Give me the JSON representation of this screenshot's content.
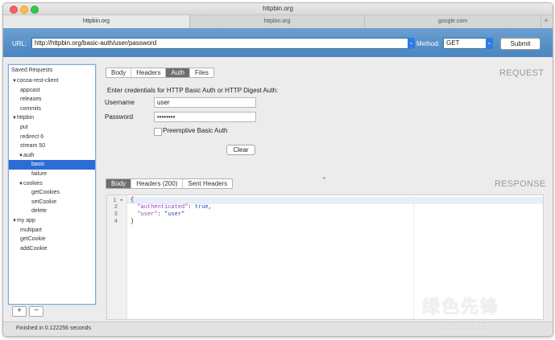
{
  "window": {
    "title": "httpbin.org"
  },
  "tabs": [
    {
      "label": "httpbin.org",
      "active": true
    },
    {
      "label": "httpbin.org",
      "active": false
    },
    {
      "label": "google.com",
      "active": false
    }
  ],
  "tab_add_label": "+",
  "urlbar": {
    "url_label": "URL:",
    "url_value": "http://httpbin.org/basic-auth/user/password",
    "method_label": "Method:",
    "method_value": "GET",
    "submit_label": "Submit"
  },
  "sidebar": {
    "title": "Saved Requests",
    "items": [
      {
        "label": "cocoa-rest-client",
        "level": 0,
        "folder": true
      },
      {
        "label": "appcast",
        "level": 2
      },
      {
        "label": "releases",
        "level": 2
      },
      {
        "label": "commits",
        "level": 2
      },
      {
        "label": "httpbin",
        "level": 0,
        "folder": true
      },
      {
        "label": "put",
        "level": 2
      },
      {
        "label": "redirect 6",
        "level": 2
      },
      {
        "label": "stream 50",
        "level": 2
      },
      {
        "label": "auth",
        "level": 1,
        "folder": true
      },
      {
        "label": "basic",
        "level": 3,
        "selected": true
      },
      {
        "label": "failure",
        "level": 3
      },
      {
        "label": "cookies",
        "level": 1,
        "folder": true
      },
      {
        "label": "getCookies",
        "level": 3
      },
      {
        "label": "setCookie",
        "level": 3
      },
      {
        "label": "delete",
        "level": 3
      },
      {
        "label": "my app",
        "level": 0,
        "folder": true
      },
      {
        "label": "multipart",
        "level": 2
      },
      {
        "label": "getCookie",
        "level": 2
      },
      {
        "label": "addCookie",
        "level": 2
      }
    ],
    "add_label": "+",
    "remove_label": "−"
  },
  "request": {
    "section_title": "REQUEST",
    "tabs": [
      {
        "label": "Body",
        "active": false
      },
      {
        "label": "Headers",
        "active": false
      },
      {
        "label": "Auth",
        "active": true
      },
      {
        "label": "Files",
        "active": false
      }
    ],
    "prompt": "Enter credentials for HTTP Basic Auth or HTTP Digest Auth:",
    "username_label": "Username",
    "username_value": "user",
    "password_label": "Password",
    "password_value": "••••••••",
    "preemptive_label": "Preemptive Basic Auth",
    "preemptive_checked": false,
    "clear_label": "Clear"
  },
  "response": {
    "section_title": "RESPONSE",
    "tabs": [
      {
        "label": "Body",
        "active": true
      },
      {
        "label": "Headers (200)",
        "active": false
      },
      {
        "label": "Sent Headers",
        "active": false
      }
    ],
    "lines": [
      {
        "num": "1",
        "fold": "▾",
        "text": "{"
      },
      {
        "num": "2",
        "key": "\"authenticated\"",
        "sep": ": ",
        "value": "true",
        "tail": ","
      },
      {
        "num": "3",
        "key": "\"user\"",
        "sep": ": ",
        "value": "\"user\"",
        "tail": ""
      },
      {
        "num": "4",
        "text": "}"
      }
    ]
  },
  "status": {
    "text": "Finished in 0.122256 seconds"
  },
  "watermark": {
    "text": "绿色先锋",
    "sub": "WWW.DOWNXIA.COM"
  }
}
